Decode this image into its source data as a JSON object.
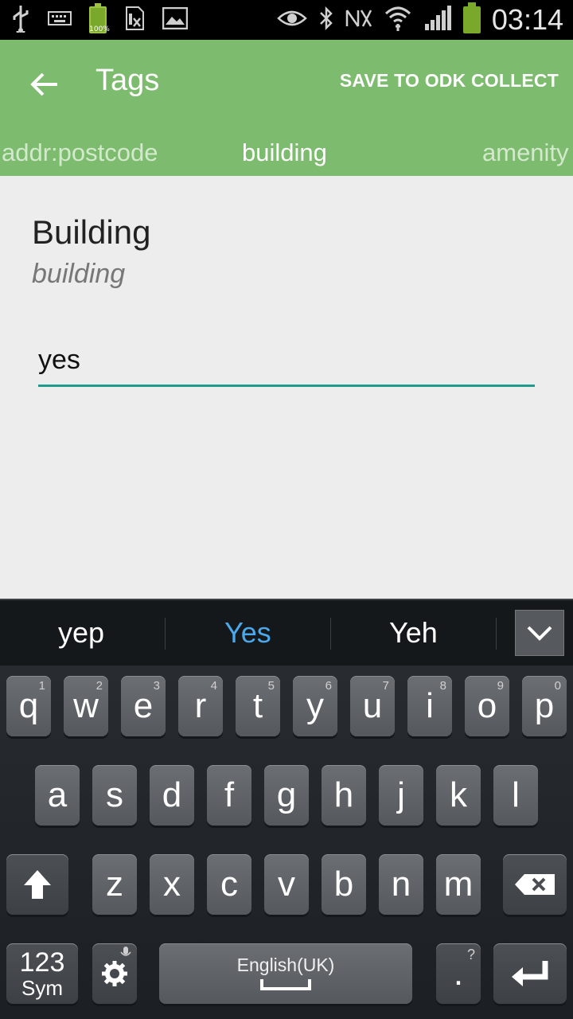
{
  "status_bar": {
    "battery_small_label": "100%",
    "time": "03:14",
    "icons": [
      "usb-icon",
      "keyboard-icon",
      "battery-small-icon",
      "sim-icon",
      "image-icon",
      "eye-icon",
      "bluetooth-icon",
      "nfc-icon",
      "wifi-icon",
      "signal-icon",
      "battery-icon"
    ]
  },
  "app_bar": {
    "title": "Tags",
    "action_label": "SAVE TO ODK COLLECT",
    "color": "#7dbb6f"
  },
  "tabs": [
    {
      "label": "addr:postcode",
      "active": false
    },
    {
      "label": "building",
      "active": true
    },
    {
      "label": "amenity",
      "active": false
    }
  ],
  "field": {
    "label": "Building",
    "key": "building",
    "value": "yes",
    "underline_color": "#1e9b8a"
  },
  "keyboard": {
    "suggestions": [
      {
        "text": "yep",
        "highlighted": false
      },
      {
        "text": "Yes",
        "highlighted": true
      },
      {
        "text": "Yeh",
        "highlighted": false
      }
    ],
    "highlight_color": "#4aa8ec",
    "row1": [
      {
        "ch": "q",
        "num": "1"
      },
      {
        "ch": "w",
        "num": "2"
      },
      {
        "ch": "e",
        "num": "3"
      },
      {
        "ch": "r",
        "num": "4"
      },
      {
        "ch": "t",
        "num": "5"
      },
      {
        "ch": "y",
        "num": "6"
      },
      {
        "ch": "u",
        "num": "7"
      },
      {
        "ch": "i",
        "num": "8"
      },
      {
        "ch": "o",
        "num": "9"
      },
      {
        "ch": "p",
        "num": "0"
      }
    ],
    "row2": [
      "a",
      "s",
      "d",
      "f",
      "g",
      "h",
      "j",
      "k",
      "l"
    ],
    "row3": [
      "z",
      "x",
      "c",
      "v",
      "b",
      "n",
      "m"
    ],
    "sym_top": "123",
    "sym_bottom": "Sym",
    "space_label": "English(UK)",
    "period_key": ".",
    "period_hint": "?"
  }
}
